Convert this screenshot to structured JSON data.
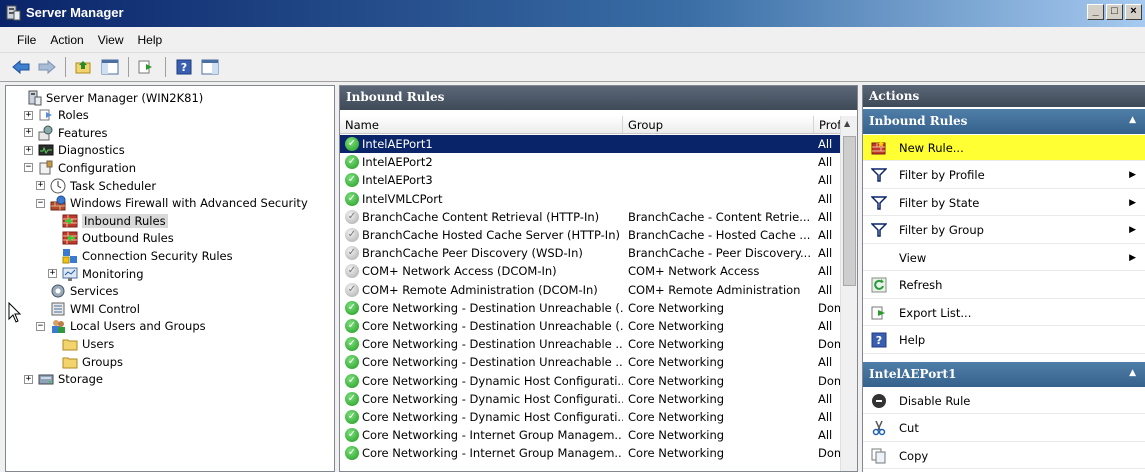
{
  "window": {
    "title": "Server Manager",
    "controls": [
      "_",
      "□",
      "×"
    ]
  },
  "menu": [
    "File",
    "Action",
    "View",
    "Help"
  ],
  "tree": [
    {
      "label": "Server Manager (WIN2K81)",
      "indent": 0,
      "expander": "",
      "icon": "server-icon"
    },
    {
      "label": "Roles",
      "indent": 1,
      "expander": "+",
      "icon": "roles-icon"
    },
    {
      "label": "Features",
      "indent": 1,
      "expander": "+",
      "icon": "features-icon"
    },
    {
      "label": "Diagnostics",
      "indent": 1,
      "expander": "+",
      "icon": "diagnostics-icon"
    },
    {
      "label": "Configuration",
      "indent": 1,
      "expander": "−",
      "icon": "configuration-icon"
    },
    {
      "label": "Task Scheduler",
      "indent": 2,
      "expander": "+",
      "icon": "clock-icon"
    },
    {
      "label": "Windows Firewall with Advanced Security",
      "indent": 2,
      "expander": "−",
      "icon": "firewall-icon"
    },
    {
      "label": "Inbound Rules",
      "indent": 3,
      "expander": "",
      "icon": "inbound-rules-icon",
      "selected": true
    },
    {
      "label": "Outbound Rules",
      "indent": 3,
      "expander": "",
      "icon": "outbound-rules-icon"
    },
    {
      "label": "Connection Security Rules",
      "indent": 3,
      "expander": "",
      "icon": "connection-security-icon"
    },
    {
      "label": "Monitoring",
      "indent": 3,
      "expander": "+",
      "icon": "monitoring-icon"
    },
    {
      "label": "Services",
      "indent": 2,
      "expander": "",
      "icon": "services-icon"
    },
    {
      "label": "WMI Control",
      "indent": 2,
      "expander": "",
      "icon": "wmi-icon"
    },
    {
      "label": "Local Users and Groups",
      "indent": 2,
      "expander": "−",
      "icon": "users-groups-icon"
    },
    {
      "label": "Users",
      "indent": 3,
      "expander": "",
      "icon": "folder-icon"
    },
    {
      "label": "Groups",
      "indent": 3,
      "expander": "",
      "icon": "folder-icon"
    },
    {
      "label": "Storage",
      "indent": 1,
      "expander": "+",
      "icon": "storage-icon"
    }
  ],
  "center": {
    "title": "Inbound Rules",
    "columns": [
      "Name",
      "Group",
      "Prof"
    ],
    "rows": [
      {
        "name": "IntelAEPort1",
        "group": "",
        "profile": "All",
        "enabled": true,
        "selected": true
      },
      {
        "name": "IntelAEPort2",
        "group": "",
        "profile": "All",
        "enabled": true
      },
      {
        "name": "IntelAEPort3",
        "group": "",
        "profile": "All",
        "enabled": true
      },
      {
        "name": "IntelVMLCPort",
        "group": "",
        "profile": "All",
        "enabled": true
      },
      {
        "name": "BranchCache Content Retrieval (HTTP-In)",
        "group": "BranchCache - Content Retrie...",
        "profile": "All",
        "enabled": false
      },
      {
        "name": "BranchCache Hosted Cache Server (HTTP-In)",
        "group": "BranchCache - Hosted Cache ...",
        "profile": "All",
        "enabled": false
      },
      {
        "name": "BranchCache Peer Discovery (WSD-In)",
        "group": "BranchCache - Peer Discovery...",
        "profile": "All",
        "enabled": false
      },
      {
        "name": "COM+ Network Access (DCOM-In)",
        "group": "COM+ Network Access",
        "profile": "All",
        "enabled": false
      },
      {
        "name": "COM+ Remote Administration (DCOM-In)",
        "group": "COM+ Remote Administration",
        "profile": "All",
        "enabled": false
      },
      {
        "name": "Core Networking - Destination Unreachable (...",
        "group": "Core Networking",
        "profile": "Dom",
        "enabled": true
      },
      {
        "name": "Core Networking - Destination Unreachable (...",
        "group": "Core Networking",
        "profile": "All",
        "enabled": true
      },
      {
        "name": "Core Networking - Destination Unreachable ...",
        "group": "Core Networking",
        "profile": "Dom",
        "enabled": true
      },
      {
        "name": "Core Networking - Destination Unreachable ...",
        "group": "Core Networking",
        "profile": "All",
        "enabled": true
      },
      {
        "name": "Core Networking - Dynamic Host Configurati...",
        "group": "Core Networking",
        "profile": "Dom",
        "enabled": true
      },
      {
        "name": "Core Networking - Dynamic Host Configurati...",
        "group": "Core Networking",
        "profile": "All",
        "enabled": true
      },
      {
        "name": "Core Networking - Dynamic Host Configurati...",
        "group": "Core Networking",
        "profile": "All",
        "enabled": true
      },
      {
        "name": "Core Networking - Internet Group Managem...",
        "group": "Core Networking",
        "profile": "All",
        "enabled": true
      },
      {
        "name": "Core Networking - Internet Group Managem...",
        "group": "Core Networking",
        "profile": "Dom",
        "enabled": true
      }
    ]
  },
  "actions": {
    "title": "Actions",
    "section1": "Inbound Rules",
    "items1": [
      {
        "label": "New Rule...",
        "icon": "new-rule-icon",
        "submenu": false,
        "highlight": true
      },
      {
        "label": "Filter by Profile",
        "icon": "filter-icon",
        "submenu": true
      },
      {
        "label": "Filter by State",
        "icon": "filter-icon",
        "submenu": true
      },
      {
        "label": "Filter by Group",
        "icon": "filter-icon",
        "submenu": true
      },
      {
        "label": "View",
        "icon": "",
        "submenu": true
      },
      {
        "label": "Refresh",
        "icon": "refresh-icon",
        "submenu": false
      },
      {
        "label": "Export List...",
        "icon": "export-icon",
        "submenu": false
      },
      {
        "label": "Help",
        "icon": "help-icon",
        "submenu": false
      }
    ],
    "section2": "IntelAEPort1",
    "items2": [
      {
        "label": "Disable Rule",
        "icon": "disable-icon",
        "submenu": false
      },
      {
        "label": "Cut",
        "icon": "cut-icon",
        "submenu": false
      },
      {
        "label": "Copy",
        "icon": "copy-icon",
        "submenu": false
      }
    ]
  }
}
